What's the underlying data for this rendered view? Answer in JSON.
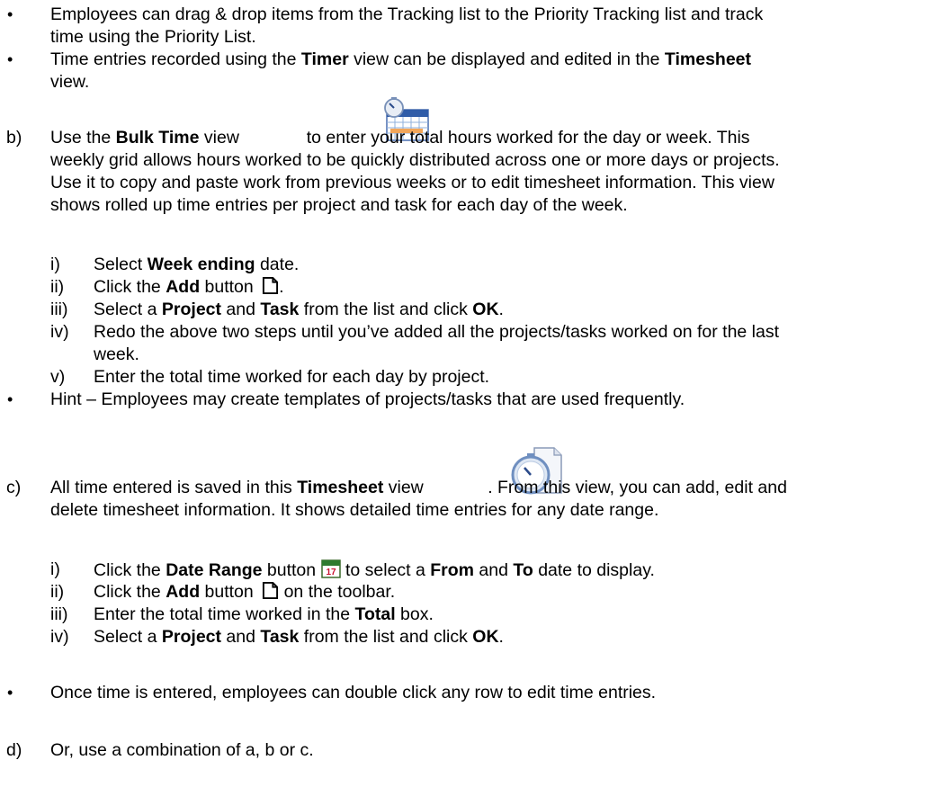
{
  "intro_bullets": [
    {
      "l1": "Employees can drag & drop items from the Tracking list to the Priority Tracking list and track",
      "l2": "time using the Priority List."
    },
    {
      "l1a": "Time entries recorded using the ",
      "l1b": "Timer",
      "l1c": " view can be displayed and edited in the ",
      "l1d": "Timesheet",
      "l2": "view."
    }
  ],
  "section_b": {
    "label": "b)",
    "p1": "Use the ",
    "p1b": "Bulk Time",
    "p1c": " view ",
    "p1d": " to enter your total hours worked for the day or week. This",
    "lines": [
      "weekly grid allows hours worked to be quickly distributed across one or more days or projects.",
      "Use it to copy and paste work from previous weeks or to edit timesheet information. This view",
      "shows rolled up time entries per project and task for each day of the week."
    ],
    "steps": {
      "i_label": "i)",
      "i_a": "Select ",
      "i_b": "Week ending",
      "i_c": " date.",
      "ii_label": "ii)",
      "ii_a": "Click the ",
      "ii_b": "Add",
      "ii_c": " button ",
      "ii_d": ".",
      "iii_label": "iii)",
      "iii_a": "Select a ",
      "iii_b": "Project",
      "iii_c": " and ",
      "iii_d": "Task",
      "iii_e": " from the list and click ",
      "iii_f": "OK",
      "iii_g": ".",
      "iv_label": "iv)",
      "iv_l1": "Redo the above two steps until you’ve added all the projects/tasks worked on for the last",
      "iv_l2": "week.",
      "v_label": "v)",
      "v_text": "Enter the total time worked for each day by project."
    },
    "hint": "Hint – Employees may create templates of projects/tasks that are used frequently."
  },
  "section_c": {
    "label": "c)",
    "p1a": "All time entered is saved in this ",
    "p1b": "Timesheet",
    "p1c": " view ",
    "p1d": ".  From this view, you can add, edit and",
    "p2": "delete timesheet information. It shows detailed time entries for any date range.",
    "steps": {
      "i_label": "i)",
      "i_a": "Click the ",
      "i_b": "Date Range",
      "i_c": " button ",
      "i_d": " to select a ",
      "i_e": "From",
      "i_f": " and ",
      "i_g": "To",
      "i_h": " date to display.",
      "ii_label": "ii)",
      "ii_a": "Click the ",
      "ii_b": "Add",
      "ii_c": " button ",
      "ii_d": " on the toolbar.",
      "iii_label": "iii)",
      "iii_a": "Enter the total time worked in the ",
      "iii_b": "Total",
      "iii_c": " box.",
      "iv_label": "iv)",
      "iv_a": "Select a ",
      "iv_b": "Project",
      "iv_c": " and ",
      "iv_d": "Task",
      "iv_e": " from the list and click ",
      "iv_f": "OK",
      "iv_g": "."
    },
    "after_bullet": "Once time is entered, employees can double click any row to edit time entries."
  },
  "section_d": {
    "label": "d)",
    "text": "Or, use a combination of a, b or c."
  },
  "icons": {
    "bulk_time": "bulk-time-calendar-stopwatch-icon",
    "add": "new-document-icon",
    "timesheet": "timesheet-stopwatch-document-icon",
    "date_range": "calendar-date-range-icon"
  },
  "bullet_glyph": "•"
}
